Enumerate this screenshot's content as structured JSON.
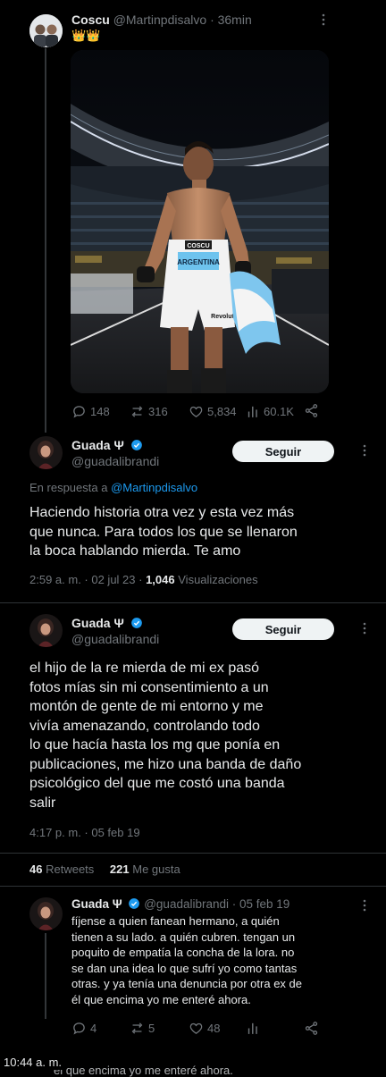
{
  "colors": {
    "background": "#000000",
    "text": "#e7e9ea",
    "muted": "#71767b",
    "accent": "#1d9bf0",
    "divider": "#2f3336",
    "liked": "#f91880",
    "retweeted": "#00ba7c"
  },
  "top_tweet": {
    "author_name": "Coscu",
    "handle": "@Martinpdisalvo",
    "time": "· 36min",
    "bio_emoji": "👑👑",
    "image": {
      "label": "photo-boxer-arena",
      "shorts_text_1": "COSCU",
      "shorts_text_2": "ARGENTINA",
      "shorts_text_3": "Revolut"
    },
    "actions": {
      "replies": "148",
      "retweets": "316",
      "likes": "5,834",
      "views": "60.1K"
    }
  },
  "reply_tweet": {
    "author_name": "Guada Ψ",
    "handle": "@guadalibrandi",
    "follow_label": "Seguir",
    "reply_prefix": "En respuesta a",
    "reply_to": "@Martinpdisalvo",
    "lines": [
      "Haciendo historia otra vez y esta vez más",
      "que nunca. Para todos los que se llenaron",
      "la boca hablando mierda. Te amo"
    ],
    "timestamp": "2:59 a. m. · 02 jul 23 ·",
    "views_count": "1,046",
    "views_label": "Visualizaciones"
  },
  "second_tweet": {
    "author_name": "Guada Ψ",
    "handle": "@guadalibrandi",
    "follow_label": "Seguir",
    "lines": [
      "el hijo de la re mierda de mi ex pasó",
      "fotos mías sin mi consentimiento a un",
      "montón de gente de mi entorno y me",
      "vivía amenazando, controlando todo",
      "lo que hacía hasta los mg que ponía en",
      "publicaciones, me hizo una banda de daño",
      "psicológico del que me costó una banda",
      "salir"
    ],
    "timestamp": "4:17 p. m. · 05 feb 19",
    "retweets_count": "46",
    "retweets_label": "Retweets",
    "likes_count": "221",
    "likes_label": "Me gusta"
  },
  "sub_tweet": {
    "author_name": "Guada Ψ",
    "handle": "@guadalibrandi",
    "time": "· 05 feb 19",
    "lines": [
      "fíjense a quien fanean hermano, a quién",
      "tienen a su lado. a quién cubren. tengan un",
      "poquito de empatía la concha de la lora. no",
      "se dan una idea lo que sufrí yo como tantas",
      "otras. y ya tenía una denuncia por otra ex de",
      "él que encima yo me enteré ahora."
    ],
    "actions": {
      "replies": "4",
      "retweets": "5",
      "likes": "48"
    }
  },
  "footer": {
    "time": "10:44 a. m.",
    "overlap_text": "él que encima yo me enteré ahora."
  }
}
